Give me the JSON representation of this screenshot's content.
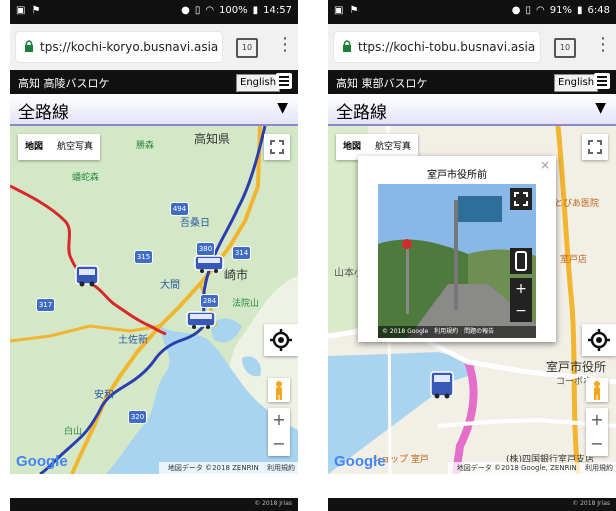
{
  "status_left": {
    "time": "14:57",
    "battery": "100%"
  },
  "status_right": {
    "time": "6:48",
    "battery": "91%"
  },
  "left": {
    "url": "tps://kochi-koryo.busnavi.asia",
    "tab_count": "10",
    "app_title": "高知 高陵バスロケ",
    "lang_button": "English",
    "route_title": "全路線",
    "map_type_map": "地図",
    "map_type_satellite": "航空写真",
    "google_logo": "Google",
    "map_attribution": "地図データ ©2018 ZENRIN",
    "terms": "利用規約",
    "copyright": "© 2018 Jrias",
    "labels": {
      "kochi_pref": "高知県",
      "katsura": "勝森",
      "azetsu": "吾桑日",
      "suzaki": "崎市",
      "omama": "大間",
      "hokkein": "法院山",
      "tosashinjo": "土佐新",
      "yasuwa": "安和",
      "gashira": "白山",
      "anjaku": "蟠蛇森"
    },
    "shields": [
      "494",
      "315",
      "380",
      "314",
      "284",
      "317",
      "320"
    ]
  },
  "right": {
    "url": "ttps://kochi-tobu.busnavi.asia",
    "tab_count": "10",
    "app_title": "高知 東部バスロケ",
    "lang_button": "English",
    "route_title": "全路線",
    "map_type_map": "地図",
    "map_type_satellite": "航空写真",
    "popup_title": "室戸市役所前",
    "popup_close": "×",
    "sv_copyright": "© 2018 Google",
    "sv_terms": "利用規約",
    "sv_report": "問題の報告",
    "google_logo": "Google",
    "map_attribution": "地図データ ©2018 Google, ZENRIN",
    "terms": "利用規約",
    "copyright": "© 2018 Jrias",
    "labels": {
      "muroto_city_hall": "室戸市役所",
      "toboe": "とびあ医院",
      "muro_shop": "室戸店",
      "coach_sta": "コーポホー",
      "bank": "(株)四国銀行室戸支店",
      "shop": "ショップ 室戸",
      "yamamoto": "山本小"
    }
  }
}
